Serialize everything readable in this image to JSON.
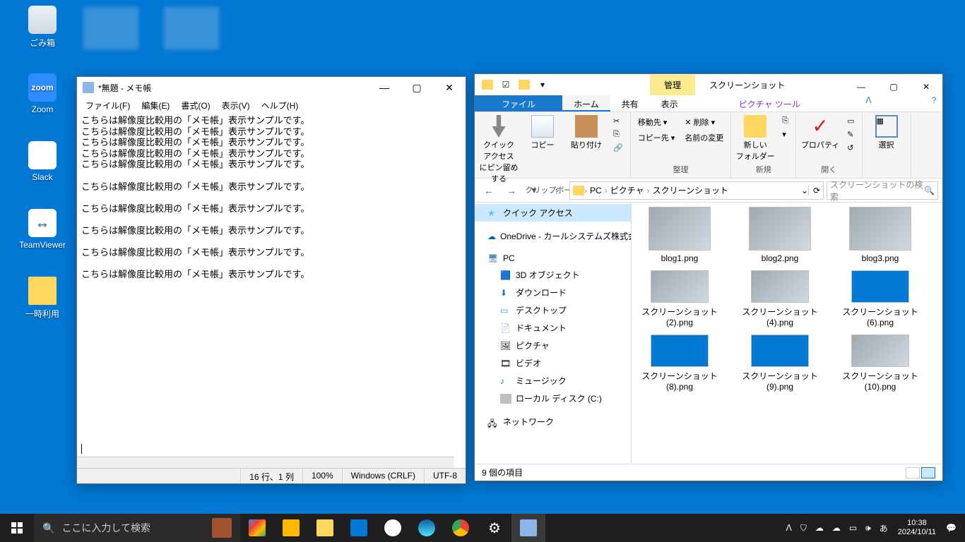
{
  "desktop_icons": [
    {
      "name": "bin",
      "label": "ごみ箱"
    },
    {
      "name": "zoom",
      "label": "Zoom"
    },
    {
      "name": "slack",
      "label": "Slack"
    },
    {
      "name": "teamviewer",
      "label": "TeamViewer"
    },
    {
      "name": "temp",
      "label": "一時利用"
    }
  ],
  "notepad": {
    "title": "*無題 - メモ帳",
    "menu": [
      "ファイル(F)",
      "編集(E)",
      "書式(O)",
      "表示(V)",
      "ヘルプ(H)"
    ],
    "line": "こちらは解像度比較用の「メモ帳」表示サンプルです。",
    "status": {
      "pos": "16 行、1 列",
      "zoom": "100%",
      "eol": "Windows (CRLF)",
      "enc": "UTF-8"
    }
  },
  "explorer": {
    "title_tab_manage": "管理",
    "title_tab_name": "スクリーンショット",
    "tabs": {
      "file": "ファイル",
      "home": "ホーム",
      "share": "共有",
      "view": "表示",
      "tool": "ピクチャ ツール"
    },
    "ribbon": {
      "pin": "クイック アクセス\nにピン留めする",
      "copy": "コピー",
      "paste": "貼り付け",
      "clipboard": "クリップボード",
      "move": "移動先",
      "copyto": "コピー先",
      "delete": "削除",
      "rename": "名前の変更",
      "organize": "整理",
      "newfolder": "新しい\nフォルダー",
      "new": "新規",
      "properties": "プロパティ",
      "open": "開く",
      "select": "選択"
    },
    "nav": {
      "back": "←",
      "forward": "→",
      "up": "↑"
    },
    "crumbs": [
      "PC",
      "ピクチャ",
      "スクリーンショット"
    ],
    "refresh": "⟳",
    "search_placeholder": "スクリーンショットの検索",
    "tree": {
      "quick": "クイック アクセス",
      "onedrive": "OneDrive - カールシステムズ株式会社",
      "pc": "PC",
      "items": [
        "3D オブジェクト",
        "ダウンロード",
        "デスクトップ",
        "ドキュメント",
        "ピクチャ",
        "ビデオ",
        "ミュージック",
        "ローカル ディスク (C:)"
      ],
      "network": "ネットワーク"
    },
    "files": [
      {
        "name": "blog1.png",
        "cls": ""
      },
      {
        "name": "blog2.png",
        "cls": ""
      },
      {
        "name": "blog3.png",
        "cls": ""
      },
      {
        "name": "スクリーンショット (2).png",
        "cls": "sm"
      },
      {
        "name": "スクリーンショット (4).png",
        "cls": "sm"
      },
      {
        "name": "スクリーンショット (6).png",
        "cls": "sm blue"
      },
      {
        "name": "スクリーンショット (8).png",
        "cls": "sm blue"
      },
      {
        "name": "スクリーンショット (9).png",
        "cls": "sm blue"
      },
      {
        "name": "スクリーンショット (10).png",
        "cls": "sm"
      }
    ],
    "status": "9 個の項目"
  },
  "taskbar": {
    "search": "ここに入力して検索",
    "ime": "あ",
    "time": "10:38",
    "date": "2024/10/11"
  }
}
